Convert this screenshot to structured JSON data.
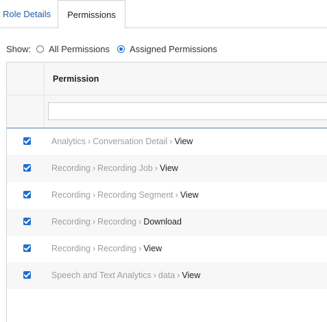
{
  "tabs": [
    {
      "label": "Role Details",
      "active": false
    },
    {
      "label": "Permissions",
      "active": true
    }
  ],
  "filter": {
    "show_label": "Show:",
    "options": [
      {
        "label": "All Permissions",
        "selected": false
      },
      {
        "label": "Assigned Permissions",
        "selected": true
      }
    ]
  },
  "table": {
    "column_header": "Permission",
    "filter_value": "",
    "rows": [
      {
        "checked": true,
        "domain": "Analytics",
        "entity": "Conversation Detail",
        "action": "View"
      },
      {
        "checked": true,
        "domain": "Recording",
        "entity": "Recording Job",
        "action": "View"
      },
      {
        "checked": true,
        "domain": "Recording",
        "entity": "Recording Segment",
        "action": "View"
      },
      {
        "checked": true,
        "domain": "Recording",
        "entity": "Recording",
        "action": "Download"
      },
      {
        "checked": true,
        "domain": "Recording",
        "entity": "Recording",
        "action": "View"
      },
      {
        "checked": true,
        "domain": "Speech and Text Analytics",
        "entity": "data",
        "action": "View"
      }
    ]
  },
  "colors": {
    "accent": "#1d6fd1",
    "link": "#1d5fa9",
    "muted_text": "#9a9ea3"
  }
}
